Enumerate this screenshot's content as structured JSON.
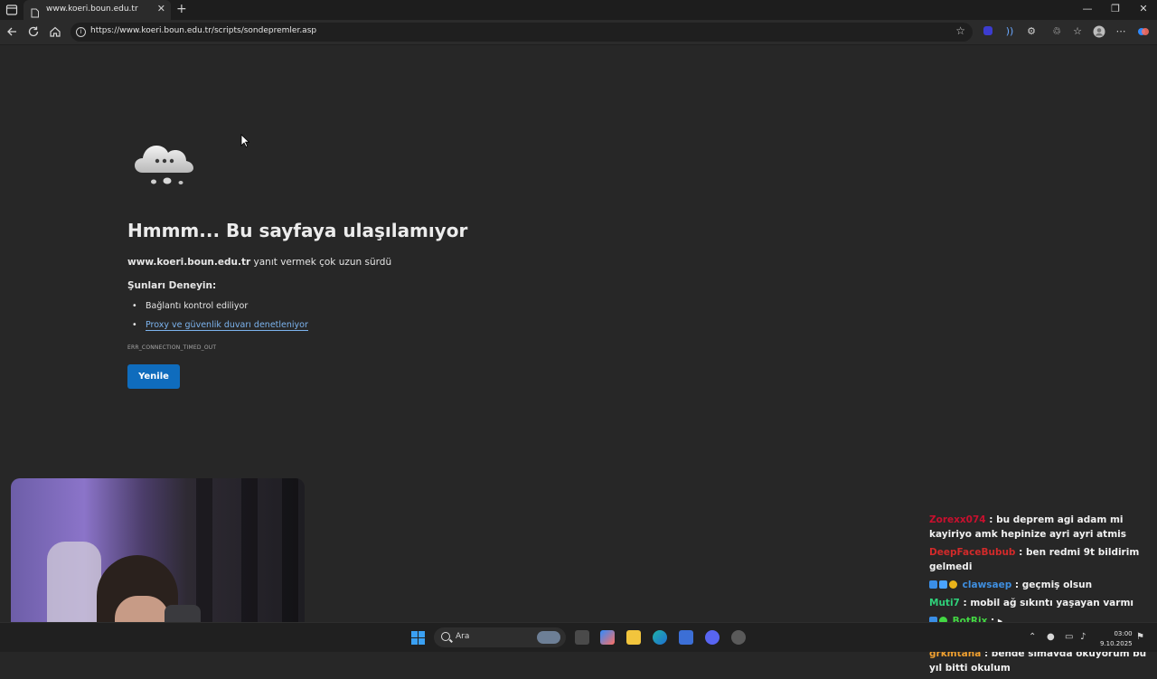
{
  "browser": {
    "tab_title": "www.koeri.boun.edu.tr",
    "tab_close": "✕",
    "new_tab": "+",
    "url": "https://www.koeri.boun.edu.tr/scripts/sondepremler.asp",
    "window_controls": {
      "minimize": "—",
      "maximize": "❐",
      "close": "✕"
    }
  },
  "error_page": {
    "title": "Hmmm... Bu sayfaya ulaşılamıyor",
    "host": "www.koeri.boun.edu.tr",
    "desc_suffix": " yanıt vermek çok uzun sürdü",
    "try_heading": "Şunları Deneyin:",
    "suggestions": {
      "check_connection": "Bağlantı kontrol ediliyor",
      "check_proxy": "Proxy ve güvenlik duvarı denetleniyor"
    },
    "error_code": "ERR_CONNECTION_TIMED_OUT",
    "reload_label": "Yenile"
  },
  "chat": {
    "messages": [
      {
        "user": "Zorexx074",
        "user_color": "#c8102e",
        "text": " : bu deprem agi adam mi kayiriyo amk hepinize ayri ayri atmis"
      },
      {
        "user": "DeepFaceBubub",
        "user_color": "#d22a2a",
        "text": " : ben redmi 9t bildirim gelmedi"
      },
      {
        "user": "clawsaep",
        "user_color": "#3f8fe0",
        "text": " : geçmiş olsun"
      },
      {
        "user": "Muti7",
        "user_color": "#2fd17a",
        "text": " : mobil ağ sıkıntı yaşayan varmı"
      },
      {
        "user": "BotRix",
        "user_color": "#43d843",
        "text": " : ▸ https://discord.com/invite/tolu"
      },
      {
        "user": "grkmtaha",
        "user_color": "#f0a030",
        "text": " : bende simavda okuyorum bu yıl bitti okulum"
      }
    ]
  },
  "taskbar": {
    "search_label": "Ara",
    "clock_time": "03:00",
    "clock_date": "9.10.2025"
  },
  "colors": {
    "accent": "#0f6cbd",
    "link": "#7cb3ee",
    "page_bg": "#272727"
  }
}
